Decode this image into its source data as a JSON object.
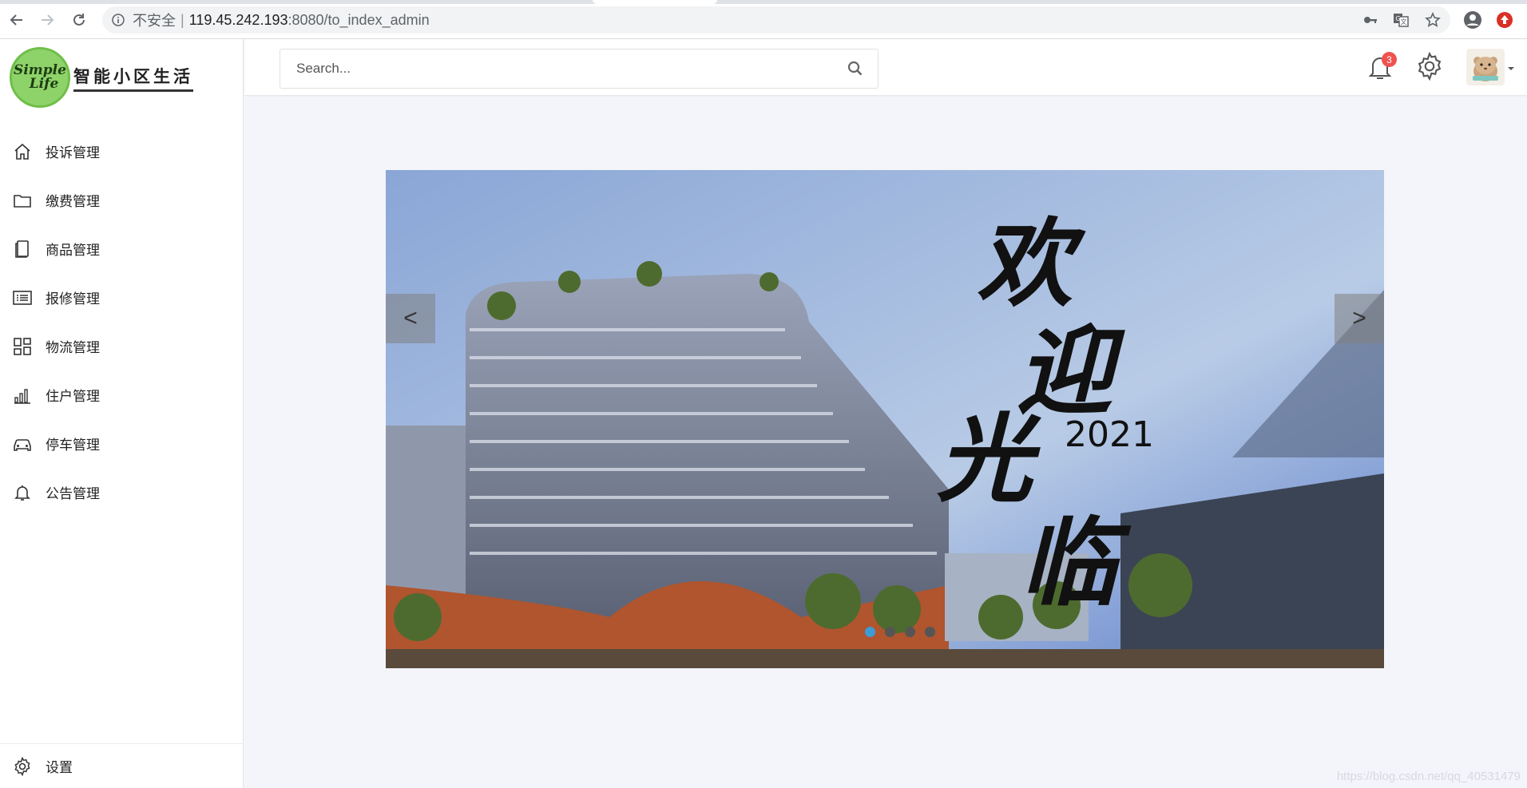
{
  "browser": {
    "insecure_label": "不安全",
    "separator": "|",
    "url_host": "119.45.242.193",
    "url_path": ":8080/to_index_admin"
  },
  "logo": {
    "circle_line1": "Simple",
    "circle_line2": "Life",
    "text": "智能小区生活"
  },
  "sidebar": {
    "items": [
      {
        "label": "投诉管理",
        "icon": "home-icon"
      },
      {
        "label": "缴费管理",
        "icon": "folder-icon"
      },
      {
        "label": "商品管理",
        "icon": "copy-icon"
      },
      {
        "label": "报修管理",
        "icon": "list-icon"
      },
      {
        "label": "物流管理",
        "icon": "grid-icon"
      },
      {
        "label": "住户管理",
        "icon": "bar-chart-icon"
      },
      {
        "label": "停车管理",
        "icon": "car-icon"
      },
      {
        "label": "公告管理",
        "icon": "bell-icon"
      }
    ],
    "footer_label": "设置"
  },
  "header": {
    "search_placeholder": "Search...",
    "notification_count": "3"
  },
  "carousel": {
    "welcome_chars": [
      "欢",
      "迎",
      "光",
      "临"
    ],
    "year": "2021",
    "prev_label": "<",
    "next_label": ">",
    "slide_count": 4,
    "active_slide": 1
  },
  "watermark": "https://blog.csdn.net/qq_40531479",
  "colors": {
    "accent": "#3d9bd6",
    "badge": "#f0534f",
    "sidebar_bg": "#ffffff",
    "content_bg": "#f4f5fb"
  }
}
